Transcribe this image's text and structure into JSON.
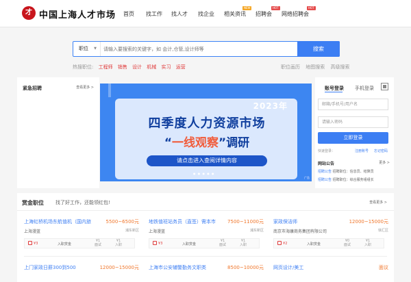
{
  "brand": {
    "logo_text": "中国上海人才市场"
  },
  "nav": {
    "items": [
      {
        "label": "首页"
      },
      {
        "label": "找工作"
      },
      {
        "label": "找人才"
      },
      {
        "label": "找企业"
      },
      {
        "label": "相关资讯",
        "badge": "NEW"
      },
      {
        "label": "招聘会",
        "badge": "HOT"
      },
      {
        "label": "网络招聘会",
        "badge": "HOT"
      }
    ]
  },
  "search": {
    "type_label": "职位",
    "placeholder": "请输入要搜索的关键字，如 会计,仓管,设计师等",
    "button_label": "搜索",
    "hot_prefix": "热搜职位:",
    "hot_keywords": [
      "工程师",
      "销售",
      "设计",
      "机械",
      "实习",
      "运营"
    ],
    "links": [
      "职位画历",
      "地图搜索",
      "高级搜索"
    ]
  },
  "urgent": {
    "title": "紧急招聘",
    "more": "查看更多 >"
  },
  "banner": {
    "year": "2023年",
    "headline": "四季度人力资源市场",
    "sub_left": "“",
    "sub_emph": "一线观察",
    "sub_right": "”调研",
    "cta": "请点击进入查阅详情内容",
    "dots": "● ● ● ● ●",
    "ad": "广告"
  },
  "login": {
    "tab_account": "账号登录",
    "tab_phone": "手机登录",
    "user_placeholder": "邮箱/手机号/用户名",
    "pwd_placeholder": "请输入密码",
    "button": "立即登录",
    "quick": "快速登录：",
    "register": "注册账号",
    "forgot": "忘记密码",
    "notice_title": "网站公告",
    "notice_more": "更多 >",
    "notices": [
      {
        "tag": "招聘公告",
        "text": "招聘职位：信息员、结算员"
      },
      {
        "tag": "招聘公告",
        "text": "招聘职位：综合服务组组长"
      }
    ]
  },
  "bounty": {
    "title": "赏金职位",
    "subtitle": "找了好工作，还能领红包!",
    "more": "查看更多 >",
    "jobs": [
      {
        "title": "上海虹桥机场东航值机（国内旅",
        "salary": "5500~6500元",
        "company": "上海漫蓝",
        "region": "浦东新区",
        "bounty": "3",
        "label": "入职赏金",
        "r1": "1",
        "r1l": "面试",
        "r2": "1",
        "r2l": "入职"
      },
      {
        "title": "地铁值班站务员（直签）需本市",
        "salary": "7500~11000元",
        "company": "上海漫蓝",
        "region": "浦东新区",
        "bounty": "3",
        "label": "入职赏金",
        "r1": "1",
        "r1l": "面试",
        "r2": "1",
        "r2l": "入职"
      },
      {
        "title": "家政保洁师",
        "salary": "12000~15000元",
        "company": "南京市海康商务集团有限公司",
        "region": "徐汇区",
        "bounty": "2",
        "label": "入职赏金",
        "r1": "0",
        "r1l": "面试",
        "r2": "1",
        "r2l": "入职"
      },
      {
        "title": "上门家政日薪300到500",
        "salary": "12000~15000元",
        "company": "",
        "region": "",
        "bounty": "",
        "label": "",
        "r1": "",
        "r1l": "",
        "r2": "",
        "r2l": ""
      },
      {
        "title": "上海市公安辅警勤务文职类",
        "salary": "8500~10000元",
        "company": "",
        "region": "",
        "bounty": "",
        "label": "",
        "r1": "",
        "r1l": "",
        "r2": "",
        "r2l": ""
      },
      {
        "title": "网页设计/美工",
        "salary": "面议",
        "company": "",
        "region": "",
        "bounty": "",
        "label": "",
        "r1": "",
        "r1l": "",
        "r2": "",
        "r2l": ""
      }
    ]
  },
  "colors": {
    "accent": "#3c7ef3",
    "salary": "#f0762b",
    "hot": "#e03a3a",
    "brand": "#c8161d"
  }
}
